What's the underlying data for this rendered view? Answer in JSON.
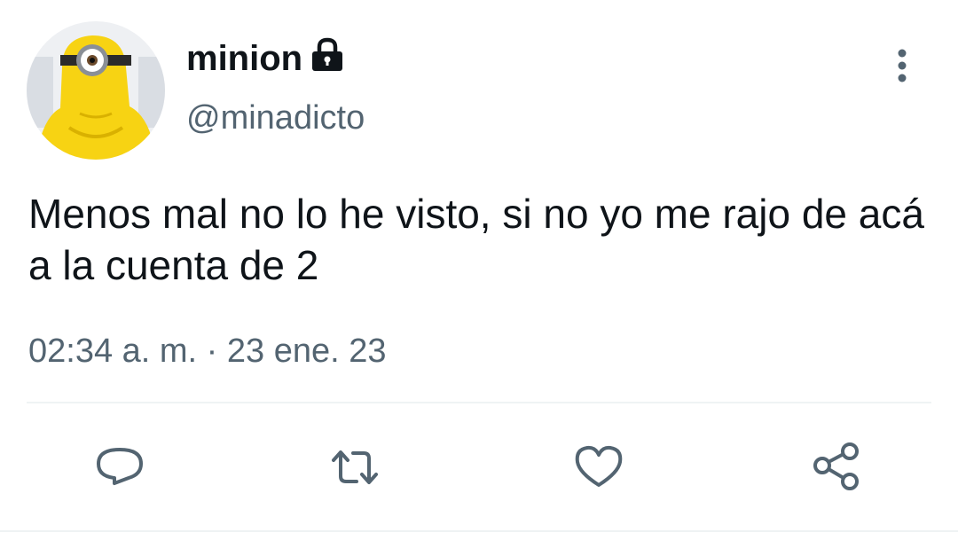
{
  "user": {
    "display_name": "minion",
    "handle": "@minadicto",
    "protected": true
  },
  "tweet": {
    "text": "Menos mal no lo he visto, si no yo me rajo de acá a la cuenta de 2",
    "timestamp": "02:34 a. m. · 23 ene. 23"
  },
  "actions": [
    "reply-icon",
    "retweet-icon",
    "like-icon",
    "share-icon"
  ],
  "colors": {
    "text_primary": "#0f1419",
    "text_secondary": "#536471",
    "icon": "#536471",
    "divider": "#eff3f4",
    "avatar_yellow": "#f7d313"
  }
}
